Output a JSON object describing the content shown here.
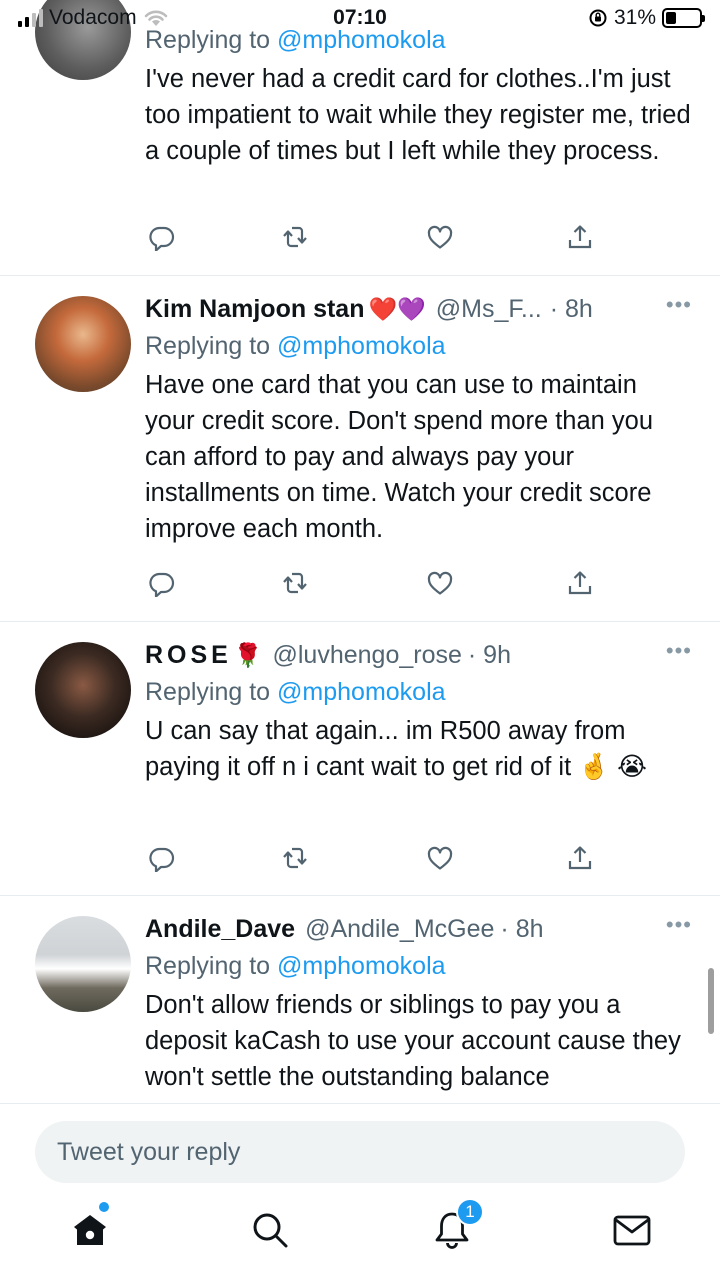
{
  "status_bar": {
    "carrier": "Vodacom",
    "time": "07:10",
    "battery": "31%",
    "battery_level": 0.31
  },
  "tweets": [
    {
      "replying_prefix": "Replying to",
      "replying_to": "@mphomokola",
      "text": "I've never had a credit card for clothes..I'm just too impatient to wait while they register me, tried a couple of times but I left while they process."
    },
    {
      "name": "Kim Namjoon stan",
      "emoji": "❤️💜",
      "handle": "@Ms_F...",
      "time": "· 8h",
      "replying_prefix": "Replying to",
      "replying_to": "@mphomokola",
      "text": "Have one card that you can use to maintain your credit score. Don't spend more than you can afford to pay and always pay your installments on time. Watch your credit score improve each month."
    },
    {
      "name": "ROSE",
      "emoji": "🌹",
      "handle": "@luvhengo_rose",
      "time": "· 9h",
      "replying_prefix": "Replying to",
      "replying_to": "@mphomokola",
      "text": "U can say that again... im R500 away from paying it off n i cant wait to get rid of it 🤞 😭"
    },
    {
      "name": "Andile_Dave",
      "handle": "@Andile_McGee",
      "time": "· 8h",
      "replying_prefix": "Replying to",
      "replying_to": "@mphomokola",
      "text": "Don't allow friends or siblings to pay you a deposit kaCash to use your account cause they won't settle the outstanding balance"
    }
  ],
  "more_label": "•••",
  "composer": {
    "placeholder": "Tweet your reply"
  },
  "notifications_count": "1",
  "colors": {
    "accent": "#1d9bf0",
    "muted": "#536471",
    "text": "#0f1419"
  }
}
